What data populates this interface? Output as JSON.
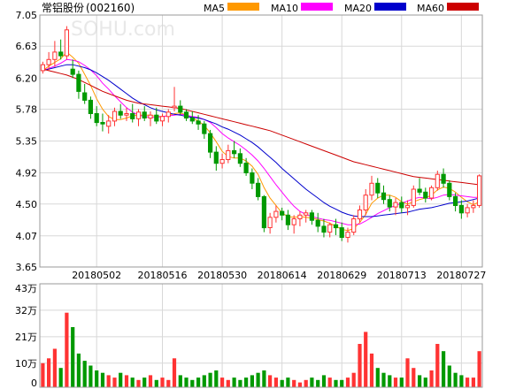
{
  "title": "常铝股份",
  "code": "(002160)",
  "watermark": "SOHU.com",
  "legend": [
    {
      "label": "MA5",
      "color": "#FF9900"
    },
    {
      "label": "MA10",
      "color": "#FF00FF"
    },
    {
      "label": "MA20",
      "color": "#0000CC"
    },
    {
      "label": "MA60",
      "color": "#CC0000"
    }
  ],
  "chart_data": [
    {
      "type": "candlestick",
      "title": "常铝股份(002160)",
      "ylim": [
        3.65,
        7.05
      ],
      "y_ticks": [
        "7.05",
        "6.63",
        "6.20",
        "5.78",
        "5.35",
        "4.92",
        "4.50",
        "4.07",
        "3.65"
      ],
      "x_tick_labels": [
        {
          "label": "20180502",
          "index": 9
        },
        {
          "label": "20180516",
          "index": 20
        },
        {
          "label": "20180530",
          "index": 30
        },
        {
          "label": "20180614",
          "index": 40
        },
        {
          "label": "20180629",
          "index": 50
        },
        {
          "label": "20180713",
          "index": 60
        },
        {
          "label": "20180727",
          "index": 70
        }
      ],
      "grid": true,
      "up_color": "#FF3333",
      "down_color": "#009900",
      "ohlc": [
        [
          6.3,
          6.42,
          6.26,
          6.38
        ],
        [
          6.38,
          6.55,
          6.3,
          6.45
        ],
        [
          6.45,
          6.7,
          6.35,
          6.55
        ],
        [
          6.55,
          6.72,
          6.45,
          6.5
        ],
        [
          6.5,
          6.9,
          6.45,
          6.85
        ],
        [
          6.32,
          6.45,
          6.2,
          6.25
        ],
        [
          6.25,
          6.3,
          5.92,
          6.02
        ],
        [
          6.0,
          6.12,
          5.85,
          5.9
        ],
        [
          5.9,
          5.95,
          5.65,
          5.72
        ],
        [
          5.72,
          5.82,
          5.55,
          5.6
        ],
        [
          5.6,
          5.72,
          5.48,
          5.58
        ],
        [
          5.55,
          5.7,
          5.45,
          5.62
        ],
        [
          5.62,
          5.8,
          5.55,
          5.75
        ],
        [
          5.75,
          5.85,
          5.65,
          5.7
        ],
        [
          5.7,
          5.8,
          5.62,
          5.72
        ],
        [
          5.72,
          5.85,
          5.6,
          5.65
        ],
        [
          5.65,
          5.78,
          5.55,
          5.74
        ],
        [
          5.74,
          5.82,
          5.62,
          5.66
        ],
        [
          5.66,
          5.75,
          5.55,
          5.7
        ],
        [
          5.7,
          5.8,
          5.58,
          5.62
        ],
        [
          5.62,
          5.72,
          5.55,
          5.68
        ],
        [
          5.68,
          5.78,
          5.6,
          5.74
        ],
        [
          5.8,
          6.08,
          5.75,
          5.82
        ],
        [
          5.82,
          5.9,
          5.7,
          5.74
        ],
        [
          5.74,
          5.78,
          5.62,
          5.66
        ],
        [
          5.66,
          5.75,
          5.58,
          5.62
        ],
        [
          5.62,
          5.7,
          5.5,
          5.58
        ],
        [
          5.58,
          5.62,
          5.38,
          5.45
        ],
        [
          5.45,
          5.5,
          5.12,
          5.2
        ],
        [
          5.2,
          5.28,
          4.95,
          5.05
        ],
        [
          5.05,
          5.18,
          4.98,
          5.1
        ],
        [
          5.1,
          5.3,
          5.05,
          5.22
        ],
        [
          5.22,
          5.35,
          5.12,
          5.18
        ],
        [
          5.18,
          5.25,
          5.0,
          5.05
        ],
        [
          5.05,
          5.12,
          4.88,
          4.92
        ],
        [
          4.92,
          4.98,
          4.7,
          4.78
        ],
        [
          4.78,
          4.85,
          4.55,
          4.6
        ],
        [
          4.6,
          4.62,
          4.12,
          4.18
        ],
        [
          4.18,
          4.38,
          4.1,
          4.32
        ],
        [
          4.32,
          4.48,
          4.25,
          4.4
        ],
        [
          4.4,
          4.45,
          4.28,
          4.35
        ],
        [
          4.35,
          4.42,
          4.15,
          4.22
        ],
        [
          4.22,
          4.35,
          4.1,
          4.3
        ],
        [
          4.3,
          4.4,
          4.2,
          4.35
        ],
        [
          4.35,
          4.42,
          4.25,
          4.38
        ],
        [
          4.38,
          4.42,
          4.22,
          4.28
        ],
        [
          4.28,
          4.38,
          4.12,
          4.2
        ],
        [
          4.2,
          4.3,
          4.05,
          4.12
        ],
        [
          4.12,
          4.25,
          4.05,
          4.22
        ],
        [
          4.22,
          4.3,
          4.08,
          4.18
        ],
        [
          4.18,
          4.25,
          4.0,
          4.05
        ],
        [
          4.05,
          4.18,
          3.98,
          4.12
        ],
        [
          4.12,
          4.35,
          4.08,
          4.3
        ],
        [
          4.3,
          4.48,
          4.25,
          4.42
        ],
        [
          4.42,
          4.7,
          4.35,
          4.62
        ],
        [
          4.62,
          4.88,
          4.55,
          4.78
        ],
        [
          4.78,
          4.85,
          4.58,
          4.65
        ],
        [
          4.65,
          4.75,
          4.5,
          4.56
        ],
        [
          4.56,
          4.62,
          4.4,
          4.46
        ],
        [
          4.46,
          4.58,
          4.35,
          4.52
        ],
        [
          4.52,
          4.6,
          4.38,
          4.45
        ],
        [
          4.45,
          4.55,
          4.35,
          4.48
        ],
        [
          4.48,
          4.75,
          4.45,
          4.7
        ],
        [
          4.7,
          4.85,
          4.62,
          4.66
        ],
        [
          4.66,
          4.72,
          4.52,
          4.58
        ],
        [
          4.58,
          4.75,
          4.55,
          4.72
        ],
        [
          4.72,
          4.95,
          4.68,
          4.9
        ],
        [
          4.9,
          4.98,
          4.72,
          4.78
        ],
        [
          4.78,
          4.82,
          4.55,
          4.6
        ],
        [
          4.6,
          4.65,
          4.4,
          4.48
        ],
        [
          4.48,
          4.55,
          4.3,
          4.38
        ],
        [
          4.38,
          4.5,
          4.32,
          4.45
        ],
        [
          4.45,
          4.55,
          4.38,
          4.48
        ],
        [
          4.48,
          4.9,
          4.45,
          4.88
        ]
      ],
      "ma": [
        {
          "name": "MA5",
          "color": "#FF9900",
          "values": [
            6.3,
            6.36,
            6.41,
            6.46,
            6.55,
            6.48,
            6.4,
            6.25,
            6.1,
            5.92,
            5.78,
            5.68,
            5.64,
            5.64,
            5.66,
            5.69,
            5.7,
            5.7,
            5.7,
            5.68,
            5.68,
            5.69,
            5.72,
            5.73,
            5.7,
            5.66,
            5.62,
            5.56,
            5.46,
            5.34,
            5.21,
            5.14,
            5.12,
            5.12,
            5.08,
            5.01,
            4.9,
            4.72,
            4.58,
            4.48,
            4.38,
            4.33,
            4.32,
            4.33,
            4.32,
            4.31,
            4.29,
            4.27,
            4.24,
            4.2,
            4.16,
            4.14,
            4.17,
            4.25,
            4.36,
            4.51,
            4.58,
            4.62,
            4.62,
            4.59,
            4.53,
            4.5,
            4.53,
            4.56,
            4.58,
            4.62,
            4.69,
            4.73,
            4.71,
            4.66,
            4.59,
            4.53,
            4.49,
            4.53
          ]
        },
        {
          "name": "MA10",
          "color": "#FF00FF",
          "values": [
            6.3,
            6.33,
            6.36,
            6.4,
            6.45,
            6.44,
            6.42,
            6.37,
            6.31,
            6.23,
            6.13,
            6.05,
            5.96,
            5.88,
            5.8,
            5.74,
            5.7,
            5.68,
            5.67,
            5.67,
            5.68,
            5.69,
            5.7,
            5.71,
            5.7,
            5.68,
            5.67,
            5.64,
            5.6,
            5.53,
            5.45,
            5.39,
            5.34,
            5.29,
            5.23,
            5.16,
            5.08,
            4.98,
            4.87,
            4.76,
            4.66,
            4.56,
            4.47,
            4.4,
            4.36,
            4.33,
            4.31,
            4.29,
            4.28,
            4.26,
            4.24,
            4.22,
            4.22,
            4.23,
            4.27,
            4.32,
            4.37,
            4.41,
            4.45,
            4.48,
            4.51,
            4.54,
            4.57,
            4.59,
            4.58,
            4.57,
            4.59,
            4.62,
            4.63,
            4.62,
            4.61,
            4.6,
            4.59,
            4.59
          ]
        },
        {
          "name": "MA20",
          "color": "#0000CC",
          "values": [
            6.3,
            6.32,
            6.34,
            6.36,
            6.38,
            6.38,
            6.36,
            6.34,
            6.31,
            6.27,
            6.22,
            6.17,
            6.11,
            6.05,
            5.99,
            5.93,
            5.88,
            5.84,
            5.8,
            5.77,
            5.75,
            5.73,
            5.71,
            5.7,
            5.68,
            5.67,
            5.66,
            5.64,
            5.61,
            5.58,
            5.54,
            5.51,
            5.47,
            5.43,
            5.38,
            5.33,
            5.27,
            5.2,
            5.13,
            5.06,
            4.98,
            4.91,
            4.84,
            4.77,
            4.7,
            4.64,
            4.58,
            4.52,
            4.47,
            4.43,
            4.39,
            4.36,
            4.34,
            4.33,
            4.33,
            4.33,
            4.34,
            4.35,
            4.36,
            4.37,
            4.38,
            4.39,
            4.41,
            4.43,
            4.44,
            4.45,
            4.47,
            4.49,
            4.51,
            4.52,
            4.53,
            4.54,
            4.56,
            4.58
          ]
        },
        {
          "name": "MA60",
          "color": "#CC0000",
          "values": [
            6.32,
            6.3,
            6.28,
            6.26,
            6.24,
            6.21,
            6.18,
            6.14,
            6.1,
            6.06,
            6.02,
            5.99,
            5.96,
            5.93,
            5.9,
            5.88,
            5.86,
            5.85,
            5.84,
            5.83,
            5.82,
            5.81,
            5.8,
            5.79,
            5.77,
            5.75,
            5.73,
            5.71,
            5.69,
            5.67,
            5.65,
            5.63,
            5.61,
            5.59,
            5.57,
            5.55,
            5.53,
            5.51,
            5.49,
            5.46,
            5.43,
            5.4,
            5.37,
            5.34,
            5.31,
            5.28,
            5.25,
            5.22,
            5.19,
            5.16,
            5.13,
            5.1,
            5.07,
            5.05,
            5.03,
            5.01,
            4.99,
            4.97,
            4.95,
            4.93,
            4.91,
            4.89,
            4.87,
            4.86,
            4.85,
            4.84,
            4.83,
            4.82,
            4.81,
            4.8,
            4.79,
            4.78,
            4.77,
            4.76
          ]
        }
      ]
    },
    {
      "type": "bar",
      "title": "",
      "ylim": [
        0,
        43
      ],
      "y_ticks": [
        "43万",
        "32万",
        "21万",
        "10万",
        "0"
      ],
      "unit": "万",
      "grid": true,
      "volume": [
        10,
        12,
        16,
        8,
        31,
        25,
        14,
        11,
        9,
        7,
        6,
        5,
        4,
        6,
        5,
        4,
        3,
        4,
        5,
        3,
        4,
        3,
        12,
        5,
        4,
        3,
        4,
        5,
        6,
        7,
        4,
        3,
        4,
        3,
        4,
        5,
        6,
        7,
        5,
        4,
        3,
        4,
        3,
        2,
        3,
        4,
        3,
        5,
        4,
        3,
        3,
        4,
        6,
        18,
        23,
        14,
        8,
        6,
        5,
        4,
        4,
        12,
        8,
        5,
        4,
        7,
        18,
        15,
        9,
        6,
        5,
        4,
        4,
        15
      ]
    }
  ]
}
